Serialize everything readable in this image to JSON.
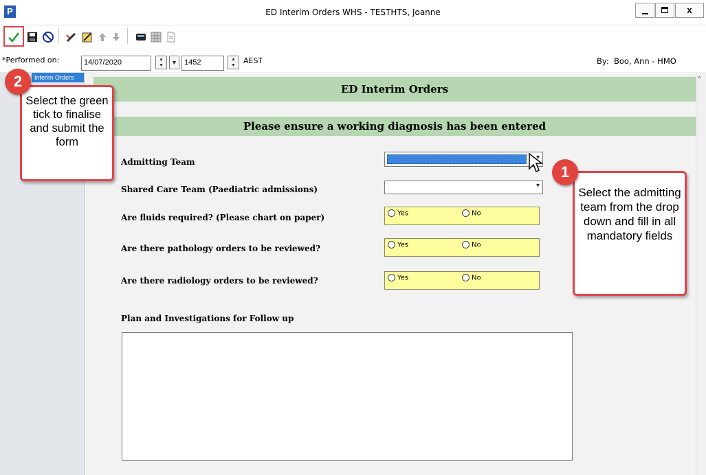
{
  "window": {
    "app_icon": "P",
    "title": "ED Interim Orders WHS - TESTHTS, Joanne",
    "close_symbol": "x"
  },
  "toolbar": {
    "icons": [
      "green-tick-icon",
      "save-icon",
      "cancel-icon",
      "edit-pen-icon",
      "edit-form-icon",
      "up-arrow-icon",
      "down-arrow-icon",
      "calculator-icon",
      "grid-icon",
      "document-icon"
    ]
  },
  "performed": {
    "label": "*Performed on:",
    "date": "14/07/2020",
    "time": "1452",
    "timezone": "AEST",
    "by_label": "By:",
    "by_value": "Boo, Ann  - HMO"
  },
  "left_panel": {
    "selected_item": "Interim Orders"
  },
  "form": {
    "header": "ED Interim Orders",
    "subheader": "Please ensure a working diagnosis has been entered",
    "admitting_team_label": "Admitting Team",
    "shared_care_label": "Shared Care Team (Paediatric admissions)",
    "fluids_label": "Are fluids required? (Please chart on paper)",
    "pathology_label": "Are there pathology orders to be reviewed?",
    "radiology_label": "Are there radiology orders to be reviewed?",
    "yes_label": "Yes",
    "no_label": "No",
    "plan_label": "Plan and Investigations for Follow up"
  },
  "callouts": {
    "one_number": "1",
    "one_text": "Select the admitting team from the drop down and fill in all mandatory fields",
    "two_number": "2",
    "two_text": "Select the green tick to finalise and submit the form"
  },
  "colors": {
    "green_bar": "#b5d6b0",
    "radio_bg": "#fefe9e",
    "callout_border": "#e2444a",
    "selected_blue": "#3c86e0"
  }
}
